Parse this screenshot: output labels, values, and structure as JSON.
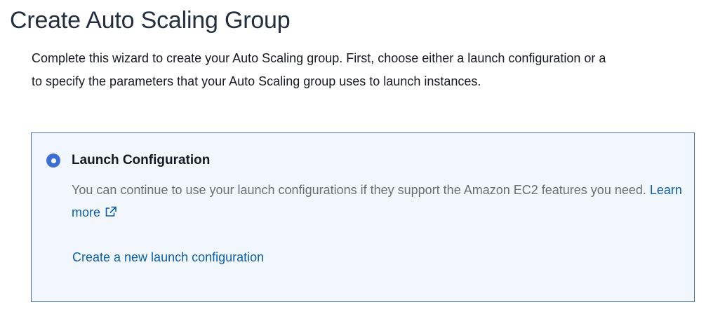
{
  "page": {
    "title": "Create Auto Scaling Group",
    "intro_line1": "Complete this wizard to create your Auto Scaling group. First, choose either a launch configuration or a",
    "intro_line2": "to specify the parameters that your Auto Scaling group uses to launch instances."
  },
  "launch_option": {
    "selected": true,
    "label": "Launch Configuration",
    "description": "You can continue to use your launch configurations if they support the Amazon EC2 features you need.",
    "learn_more": "Learn more",
    "learn_more_icon": "external-link-icon",
    "create_link": "Create a new launch configuration"
  },
  "colors": {
    "accent": "#3b6fd4",
    "link": "#0b5ea8",
    "panel_background": "#f1f7fd",
    "panel_border": "#4a72a8",
    "muted_text": "#687078"
  }
}
